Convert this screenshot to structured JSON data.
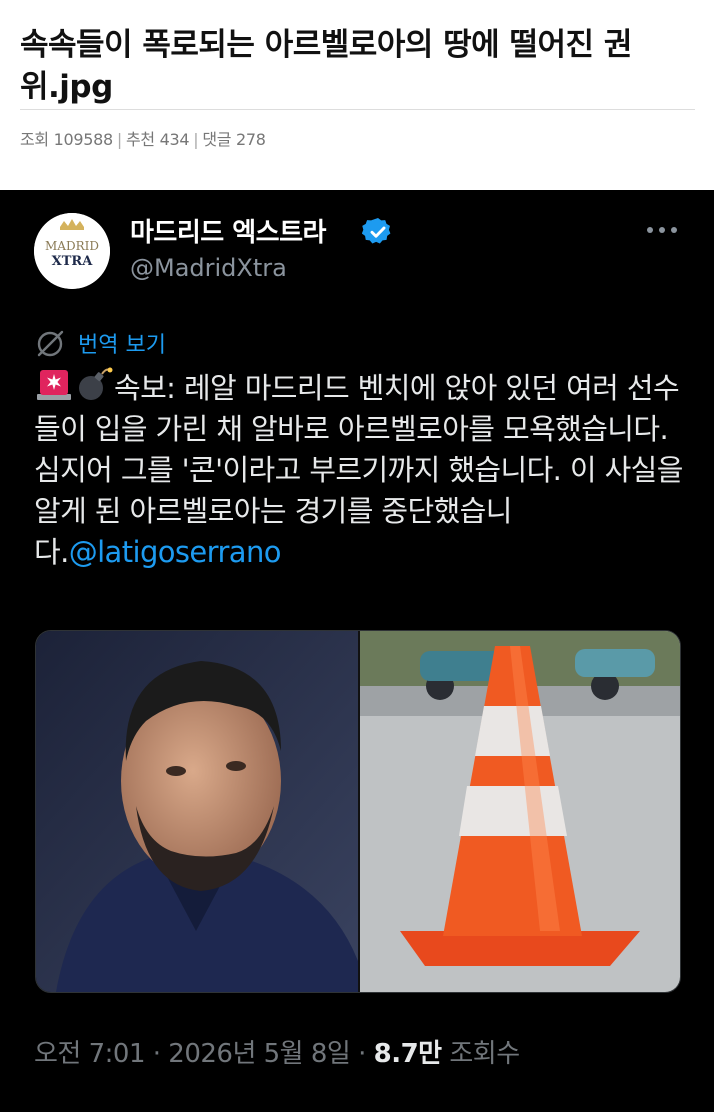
{
  "post": {
    "title": "속속들이 폭로되는 아르벨로아의 땅에 떨어진 권위.jpg",
    "meta": {
      "views_label": "조회",
      "views": "109588",
      "recommend_label": "추천",
      "recommend": "434",
      "comments_label": "댓글",
      "comments": "278"
    }
  },
  "tweet": {
    "display_name": "마드리드 엑스트라",
    "handle": "@MadridXtra",
    "avatar_text_top": "MADRID",
    "avatar_text_bottom": "XTRA",
    "translate_label": "번역 보기",
    "body_text": "속보: 레알 마드리드 벤치에 앉아 있던 여러 선수들이 입을 가린 채 알바로 아르벨로아를 모욕했습니다. 심지어 그를 '콘'이라고 부르기까지 했습니다. 이 사실을 알게 된 아르벨로아는 경기를 중단했습니다.",
    "mention": "@latigoserrano",
    "timestamp": "오전 7:01 · 2026년 5월 8일 · ",
    "views_count": "8.7만",
    "views_label": " 조회수",
    "icons": {
      "verified": "verified-badge-icon",
      "more": "more-options-icon",
      "translate": "globe-translate-icon",
      "emoji_1": "rotating-light-emoji",
      "emoji_2": "bomb-emoji"
    },
    "colors": {
      "accent": "#1d9bf0",
      "background": "#000000",
      "muted": "#71767b"
    }
  }
}
